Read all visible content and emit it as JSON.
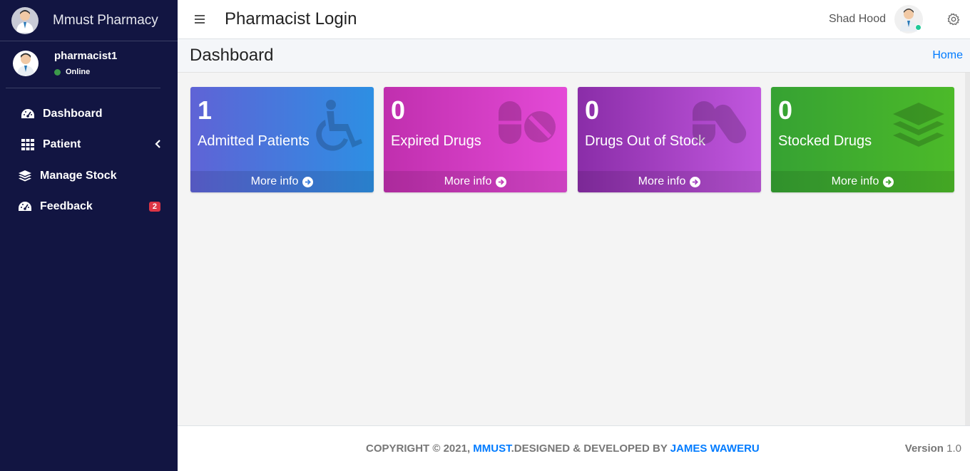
{
  "sidebar": {
    "brand": "Mmust Pharmacy",
    "user": {
      "name": "pharmacist1",
      "status": "Online"
    },
    "items": [
      {
        "label": "Dashboard",
        "icon": "tachometer-icon"
      },
      {
        "label": "Patient",
        "icon": "grid-icon"
      },
      {
        "label": "Manage Stock",
        "icon": "layers-icon"
      },
      {
        "label": "Feedback",
        "icon": "tachometer-icon",
        "badge": "2"
      }
    ]
  },
  "header": {
    "title": "Pharmacist Login",
    "user_name": "Shad Hood"
  },
  "content_header": {
    "title": "Dashboard",
    "breadcrumb": "Home"
  },
  "cards": [
    {
      "value": "1",
      "label": "Admitted Patients",
      "link": "More info",
      "icon": "wheelchair-icon",
      "color": "#4a78de"
    },
    {
      "value": "0",
      "label": "Expired Drugs",
      "link": "More info",
      "icon": "pills-icon",
      "color": "#d23cc4"
    },
    {
      "value": "0",
      "label": "Drugs Out of Stock",
      "link": "More info",
      "icon": "capsules-icon",
      "color": "#a541c4"
    },
    {
      "value": "0",
      "label": "Stocked Drugs",
      "link": "More info",
      "icon": "layers-icon",
      "color": "#42b02e"
    }
  ],
  "footer": {
    "copyright_prefix": "COPYRIGHT © 2021,",
    "org": "MMUST",
    "middle": ".DESIGNED & DEVELOPED BY",
    "author": "JAMES WAWERU",
    "version_label": "Version",
    "version_value": "1.0"
  }
}
